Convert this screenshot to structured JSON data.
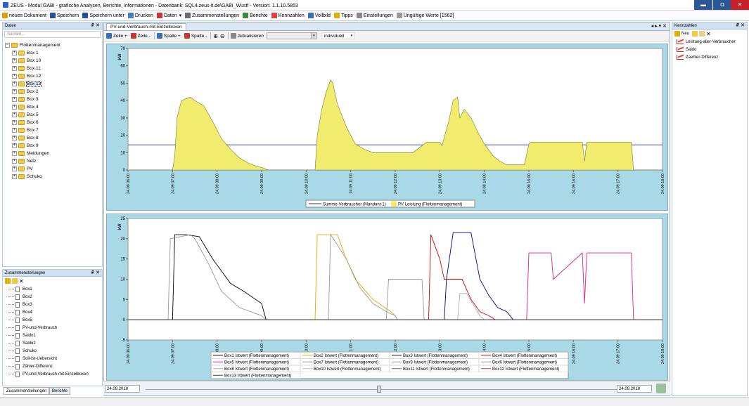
{
  "window": {
    "title": "ZEUS - Modul GABI - grafische Analysen, Berichte, Informationen - Datenbank: SQL4.zeus-it.de\\GABI_Wustf - Version:  1.1.10.5853",
    "min": "▬",
    "max": "◘",
    "close": "✕"
  },
  "toolbar": [
    {
      "label": "neues Dokument",
      "color": "#d9a200"
    },
    {
      "label": "Speichern",
      "color": "#2a4e9a"
    },
    {
      "label": "Speichern unter",
      "color": "#2a4e9a"
    },
    {
      "label": "Drucken",
      "color": "#4a7fbf"
    },
    {
      "label": "Daten",
      "color": "#c43838",
      "dropdown": "▾"
    },
    {
      "label": "Zusammenstellungen",
      "color": "#6b6b6b"
    },
    {
      "label": "Berichte",
      "color": "#3a8a3a"
    },
    {
      "label": "Kennzahlen",
      "color": "#d94444"
    },
    {
      "label": "Vollbild",
      "color": "#3d6fb8"
    },
    {
      "label": "Tipps",
      "color": "#e0b000"
    },
    {
      "label": "Einstellungen",
      "color": "#888888"
    },
    {
      "label": "Ungültige Werte [1562]",
      "color": "#999999"
    }
  ],
  "daten": {
    "title": "Daten",
    "pin": "₽ ✕",
    "search_placeholder": "Suchen...",
    "root": "Flottenmanagement",
    "items": [
      "Box 1",
      "Box 10",
      "Box 11",
      "Box 12",
      "Box 13",
      "Box 2",
      "Box 3",
      "Box 4",
      "Box 5",
      "Box 6",
      "Box 7",
      "Box 8",
      "Box 9",
      "Meldungen",
      "Netz",
      "PV",
      "Schuko"
    ],
    "selected_index": 4
  },
  "zusammen": {
    "title": "Zusammenstellungen",
    "pin": "₽ ✕",
    "items": [
      "Box1",
      "Box2",
      "Box3",
      "Box4",
      "Box5",
      "PV-und-Verbrauch",
      "Saldo1",
      "Saldo2",
      "Schuko",
      "Soll-Ist-Uebersicht",
      "Zähler-Differenz",
      "PV-und-Verbrauch-mit-Einzelboxen"
    ]
  },
  "bottom_tabs": [
    "Zusammenstellungen",
    "Berichte"
  ],
  "document": {
    "tab": "PV-und-Verbrauch-mit-Einzelboxen",
    "tab_controls": "◂ ▸ ▾ ✕",
    "tools": {
      "zeile_add": "Zeile +",
      "zeile_remove": "Zeile -",
      "spalte_add": "Spalte +",
      "spalte_remove": "Spalte -",
      "aktualisieren": "Aktualisieren",
      "mode": "individuell"
    }
  },
  "kennzahlen": {
    "title": "Kennzahlen",
    "pin": "₽ ✕",
    "new": "Neu",
    "items": [
      "Leistung-aller-Verbraucher",
      "Saldo",
      "Zaehler-Differenz"
    ]
  },
  "timebar": {
    "from": "24.09.2018",
    "to": "24.09.2018"
  },
  "chart_data": [
    {
      "type": "area",
      "ylabel": "kW",
      "ylim": [
        0,
        70
      ],
      "yticks": [
        0,
        10,
        20,
        30,
        40,
        50,
        60,
        70
      ],
      "xlabels": [
        "24.09 06:00",
        "24.09 07:00",
        "24.09 08:00",
        "24.09 09:00",
        "24.09 10:00",
        "24.09 11:00",
        "24.09 12:00",
        "24.09 13:00",
        "24.09 14:00",
        "24.09 15:00",
        "24.09 16:00",
        "24.09 17:00",
        "24.09 18:00"
      ],
      "series": [
        {
          "name": "Summe-Verbraucher (Mandant-1)",
          "kind": "line",
          "color": "#2f2f8f",
          "x": [
            6,
            18
          ],
          "y": [
            14.5,
            14.5
          ]
        },
        {
          "name": "PV Leistung (Flottenmanagement)",
          "kind": "area",
          "color": "#f2ec6e",
          "x": [
            6.0,
            7.0,
            7.05,
            7.1,
            7.2,
            7.3,
            7.4,
            7.5,
            7.7,
            7.9,
            8.1,
            8.3,
            8.5,
            8.7,
            8.9,
            9.0,
            9.1,
            9.15,
            10.2,
            10.25,
            10.35,
            10.45,
            10.55,
            10.6,
            10.7,
            10.9,
            11.1,
            11.3,
            11.5,
            11.7,
            11.9,
            12.1,
            12.4,
            12.7,
            12.9,
            13.0,
            13.05,
            13.2,
            13.3,
            13.4,
            13.45,
            13.55,
            13.7,
            13.85,
            14.0,
            14.2,
            14.35,
            14.5,
            14.6,
            14.9,
            15.0,
            15.05,
            15.5,
            16.2,
            16.25,
            16.3,
            16.5,
            17.0,
            17.3,
            17.35,
            18.0
          ],
          "y": [
            0,
            0,
            8,
            30,
            40,
            41,
            42,
            40,
            37,
            28,
            18,
            12,
            7,
            4,
            2,
            1.5,
            0.5,
            0,
            0,
            20,
            35,
            45,
            52,
            50,
            38,
            25,
            15,
            12,
            10,
            10,
            10,
            10,
            10,
            16,
            16,
            16,
            14,
            28,
            40,
            42,
            30,
            35,
            30,
            22,
            15,
            8,
            5,
            3,
            3,
            3,
            15,
            16,
            16,
            16,
            5,
            16,
            16,
            16,
            16,
            0,
            0
          ]
        }
      ]
    },
    {
      "type": "line",
      "ylabel": "kW",
      "ylim": [
        -5,
        25
      ],
      "yticks": [
        -5,
        0,
        5,
        10,
        15,
        20,
        25
      ],
      "xlabels": [
        "24.09 06:00",
        "24.09 07:00",
        "24.09 08:00",
        "24.09 09:00",
        "24.09 10:00",
        "24.09 11:00",
        "24.09 12:00",
        "24.09 13:00",
        "24.09 14:00",
        "24.09 15:00",
        "24.09 16:00",
        "24.09 17:00",
        "24.09 18:00"
      ],
      "series": [
        {
          "name": "Box1 Istwert (Flottenmanagement)",
          "color": "#000000",
          "x": [
            7.0,
            7.05,
            7.3,
            7.6,
            7.9,
            8.3,
            8.6,
            9.0,
            9.1,
            9.2
          ],
          "y": [
            0,
            21,
            21,
            20.5,
            15,
            9,
            7,
            4,
            0,
            0
          ]
        },
        {
          "name": "Box2 Istwert (Flottenmanagement)",
          "color": "#e6a800",
          "x": [
            10.2,
            10.25,
            10.7,
            10.9,
            11.1,
            11.5,
            11.9,
            12.0,
            12.05
          ],
          "y": [
            0,
            21,
            21,
            15,
            10,
            5,
            2,
            1,
            0
          ]
        },
        {
          "name": "Box3 Istwert (Flottenmanagement)",
          "color": "#000080",
          "x": [
            13.1,
            13.15,
            13.3,
            13.35,
            13.7,
            13.9,
            14.1,
            14.3,
            14.5,
            14.65,
            14.7
          ],
          "y": [
            0,
            10,
            21.5,
            21.5,
            21.5,
            10,
            6,
            3,
            2,
            0,
            0
          ]
        },
        {
          "name": "Box4 Istwert (Flottenmanagement)",
          "color": "#d00000",
          "x": [
            12.75,
            12.8,
            13.0,
            13.1,
            13.5,
            13.7,
            13.9,
            14.1,
            14.25
          ],
          "y": [
            0,
            21,
            15,
            10,
            10,
            5,
            2,
            1,
            0
          ]
        },
        {
          "name": "Box5 Istwert (Flottenmanagement)",
          "color": "#e0207a",
          "x": [
            14.95,
            15.0,
            15.5,
            15.55,
            16.2,
            16.25,
            16.3,
            17.3,
            17.35
          ],
          "y": [
            0,
            16.5,
            16.5,
            10,
            16.5,
            4,
            16.5,
            16.5,
            0
          ]
        },
        {
          "name": "Box7 Istwert (Flottenmanagement)",
          "color": "#999999",
          "x": [
            6.9,
            6.95,
            7.4,
            7.5,
            7.8,
            8.1,
            8.5,
            9.0,
            9.1
          ],
          "y": [
            0,
            20,
            21,
            20,
            14,
            7,
            3,
            1,
            0
          ]
        },
        {
          "name": "Box9 Istwert (Flottenmanagement)",
          "color": "#999999",
          "x": [
            10.5,
            10.55,
            10.9,
            11.2,
            11.5,
            11.8,
            12.0,
            12.05
          ],
          "y": [
            0,
            21,
            15,
            8,
            4,
            2,
            1,
            0
          ]
        },
        {
          "name": "Box6 Istwert (Flottenmanagement)",
          "color": "#999999",
          "x": [
            11.8,
            11.85,
            12.3,
            12.6,
            12.65,
            12.9,
            13.2,
            13.4,
            13.45
          ],
          "y": [
            0,
            10,
            10,
            10,
            0,
            0,
            0,
            0,
            0
          ]
        },
        {
          "name": "Box8 Istwert (Flottenmanagement)",
          "color": "#b0b0b0",
          "x": [
            13.4,
            13.45,
            13.6,
            13.9,
            14.0
          ],
          "y": [
            0,
            6.5,
            6.5,
            1,
            0
          ]
        },
        {
          "name": "Box10 Istwert (Flottenmanagement)",
          "color": "#bbbbbb",
          "x": [
            6,
            18
          ],
          "y": [
            0,
            0
          ]
        },
        {
          "name": "Box11 Istwert (Flottenmanagement)",
          "color": "#6666aa",
          "x": [
            6,
            18
          ],
          "y": [
            0,
            0
          ]
        },
        {
          "name": "Box12 Istwert (Flottenmanagement)",
          "color": "#c04060",
          "x": [
            6,
            18
          ],
          "y": [
            0,
            0
          ]
        },
        {
          "name": "Box13 Istwert (Flottenmanagement)",
          "color": "#444444",
          "x": [
            6,
            18
          ],
          "y": [
            0,
            0
          ]
        }
      ]
    }
  ]
}
